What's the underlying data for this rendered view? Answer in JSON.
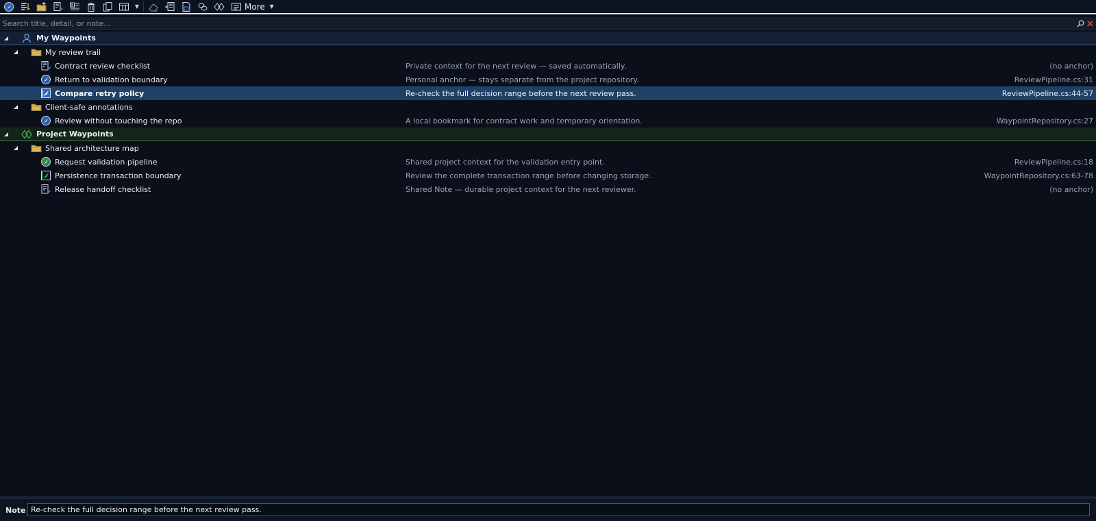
{
  "toolbar": {
    "buttons": [
      {
        "name": "add-waypoint-button",
        "icon": "compass-icon"
      },
      {
        "name": "sort-button",
        "icon": "sort-icon"
      },
      {
        "name": "new-folder-button",
        "icon": "new-folder-icon"
      },
      {
        "name": "add-note-button",
        "icon": "note-edit-icon"
      },
      {
        "name": "edit-details-button",
        "icon": "details-icon"
      },
      {
        "name": "delete-button",
        "icon": "trash-icon"
      },
      {
        "name": "copy-button",
        "icon": "copy-icon"
      },
      {
        "name": "view-columns-button",
        "icon": "columns-icon"
      }
    ],
    "more_label": "More"
  },
  "search": {
    "placeholder": "Search title, detail, or note..."
  },
  "groups": {
    "mine": {
      "label": "My Waypoints"
    },
    "project": {
      "label": "Project Waypoints"
    }
  },
  "rows": {
    "folder_trail": {
      "title": "My review trail"
    },
    "r1": {
      "title": "Contract review checklist",
      "detail": "Private context for the next review — saved automatically.",
      "anchor": "(no anchor)"
    },
    "r2": {
      "title": "Return to validation boundary",
      "detail": "Personal anchor — stays separate from the project repository.",
      "anchor": "ReviewPipeline.cs:31"
    },
    "r3": {
      "title": "Compare retry policy",
      "detail": "Re-check the full decision range before the next review pass.",
      "anchor": "ReviewPipeline.cs:44-57"
    },
    "folder_client": {
      "title": "Client-safe annotations"
    },
    "r4": {
      "title": "Review without touching the repo",
      "detail": "A local bookmark for contract work and temporary orientation.",
      "anchor": "WaypointRepository.cs:27"
    },
    "folder_shared": {
      "title": "Shared architecture map"
    },
    "r5": {
      "title": "Request validation pipeline",
      "detail": "Shared project context for the validation entry point.",
      "anchor": "ReviewPipeline.cs:18"
    },
    "r6": {
      "title": "Persistence transaction boundary",
      "detail": "Review the complete transaction range before changing storage.",
      "anchor": "WaypointRepository.cs:63-78"
    },
    "r7": {
      "title": "Release handoff checklist",
      "detail": "Shared Note — durable project context for the next reviewer.",
      "anchor": "(no anchor)"
    }
  },
  "note": {
    "label": "Note",
    "value": "Re-check the full decision range before the next review pass."
  },
  "colors": {
    "background": "#0a0f1a",
    "selected": "#1f4168",
    "mine_accent": "#3d5e93",
    "project_accent": "#3d7a48"
  }
}
